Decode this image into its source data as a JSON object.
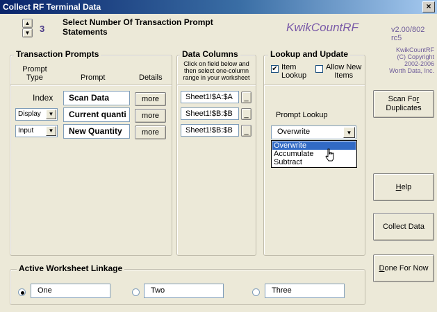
{
  "window": {
    "title": "Collect RF Terminal Data",
    "close": "×"
  },
  "header": {
    "count": "3",
    "count_line1": "Select Number Of Transaction Prompt",
    "count_line2": "Statements",
    "brand": "KwikCountRF",
    "version": "v2.00/802 rc5"
  },
  "copyright": {
    "line1": "KwikCountRF",
    "line2": "(C) Copyright",
    "line3": "2002-2006",
    "line4": "Worth Data, Inc."
  },
  "prompts": {
    "title": "Transaction Prompts",
    "col_type_1": "Prompt",
    "col_type_2": "Type",
    "col_prompt": "Prompt",
    "col_details": "Details",
    "rows": [
      {
        "type": "Index",
        "prompt": "Scan Data",
        "details": "more"
      },
      {
        "type": "Display",
        "prompt": "Current quanti",
        "details": "more"
      },
      {
        "type": "Input",
        "prompt": "New Quantity",
        "details": "more"
      }
    ]
  },
  "data_columns": {
    "title": "Data Columns",
    "hint1": "Click on field below and",
    "hint2": "then select one-column",
    "hint3": "range in your worksheet",
    "rows": [
      "Sheet1!$A:$A",
      "Sheet1!$B:$B",
      "Sheet1!$B:$B"
    ],
    "btn": "_"
  },
  "lookup": {
    "title": "Lookup and Update",
    "item_lookup_1": "Item",
    "item_lookup_2": "Lookup",
    "item_lookup_checked": true,
    "allow_new_1": "Allow New",
    "allow_new_2": "Items",
    "allow_new_checked": false,
    "prompt_label": "Prompt Lookup",
    "selected": "Overwrite",
    "options": [
      "Overwrite",
      "Accumulate",
      "Subtract"
    ]
  },
  "buttons": {
    "scan_line1_pre": "Scan Fo",
    "scan_line1_u": "r",
    "scan_line2": "Duplicates",
    "help_u": "H",
    "help_rest": "elp",
    "collect": "Collect Data",
    "done_u": "D",
    "done_rest": "one For Now"
  },
  "linkage": {
    "title": "Active Worksheet Linkage",
    "options": [
      {
        "label": "One",
        "checked": true
      },
      {
        "label": "Two",
        "checked": false
      },
      {
        "label": "Three",
        "checked": false
      }
    ]
  }
}
